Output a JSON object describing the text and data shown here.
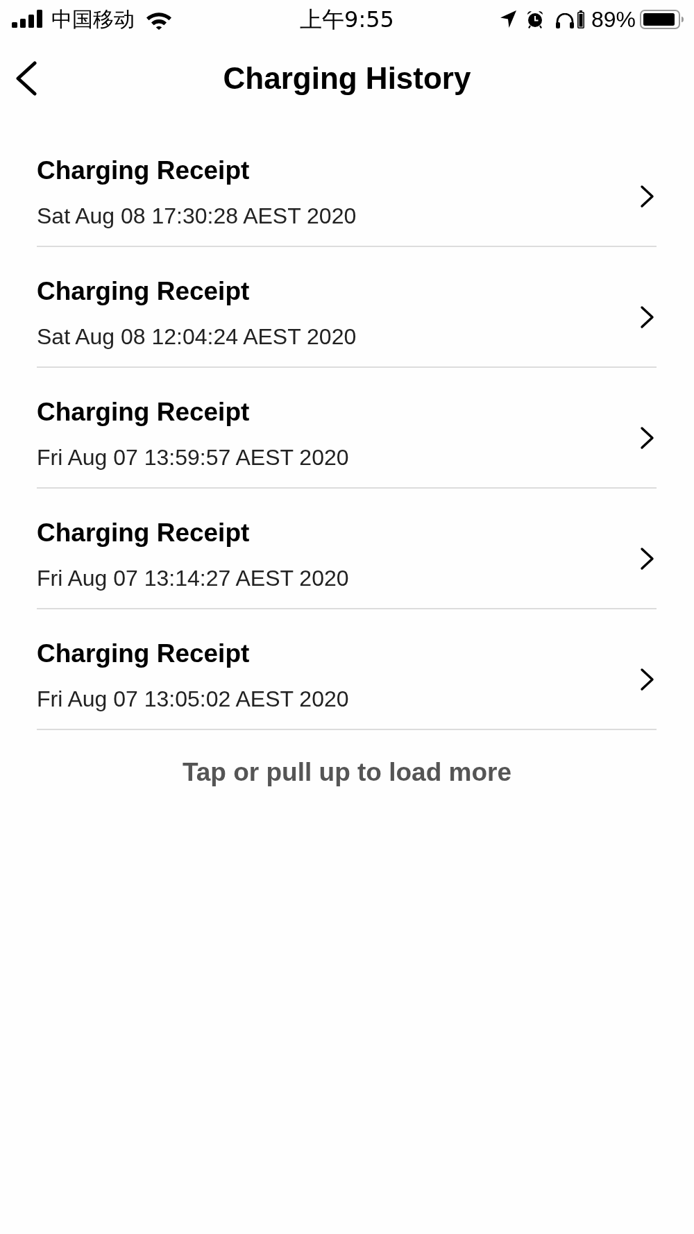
{
  "status_bar": {
    "carrier": "中国移动",
    "time": "上午9:55",
    "battery_percent": "89%"
  },
  "nav": {
    "title": "Charging History"
  },
  "receipts": [
    {
      "title": "Charging Receipt",
      "date": "Sat Aug 08 17:30:28 AEST 2020"
    },
    {
      "title": "Charging Receipt",
      "date": "Sat Aug 08 12:04:24 AEST 2020"
    },
    {
      "title": "Charging Receipt",
      "date": "Fri Aug 07 13:59:57 AEST 2020"
    },
    {
      "title": "Charging Receipt",
      "date": "Fri Aug 07 13:14:27 AEST 2020"
    },
    {
      "title": "Charging Receipt",
      "date": "Fri Aug 07 13:05:02 AEST 2020"
    }
  ],
  "load_more": "Tap or pull up to load more"
}
